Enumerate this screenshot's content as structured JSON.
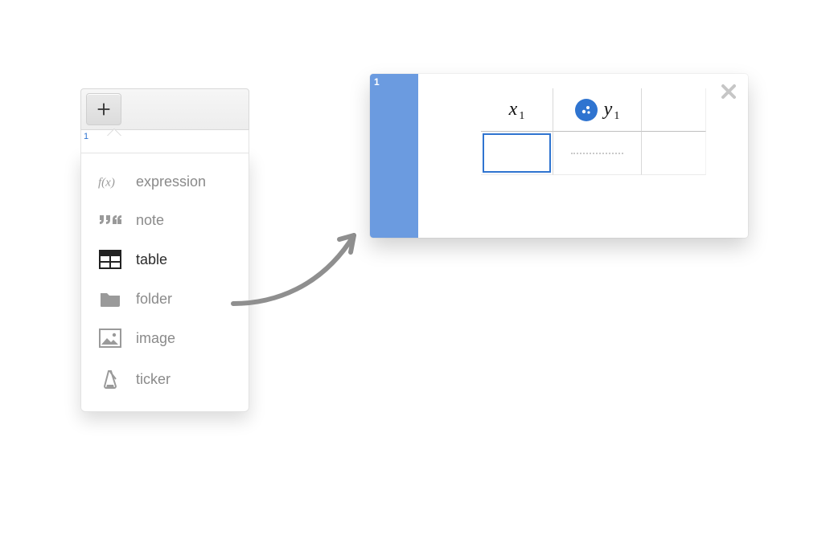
{
  "add_panel": {
    "expression_index": "1",
    "menu_items": [
      {
        "key": "expression",
        "label": "expression"
      },
      {
        "key": "note",
        "label": "note"
      },
      {
        "key": "table",
        "label": "table",
        "active": true
      },
      {
        "key": "folder",
        "label": "folder"
      },
      {
        "key": "image",
        "label": "image"
      },
      {
        "key": "ticker",
        "label": "ticker"
      }
    ]
  },
  "table_card": {
    "index": "1",
    "headers": {
      "x": {
        "var": "x",
        "sub": "1"
      },
      "y": {
        "var": "y",
        "sub": "1"
      }
    },
    "style_color": "#2f74d0"
  }
}
